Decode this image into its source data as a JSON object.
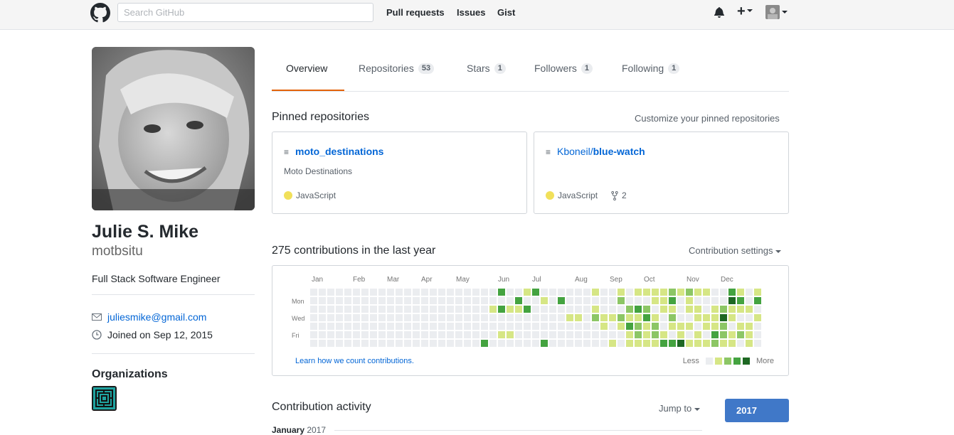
{
  "header": {
    "search_placeholder": "Search GitHub",
    "nav": [
      "Pull requests",
      "Issues",
      "Gist"
    ],
    "icons": [
      "github-logo-icon",
      "bell-icon",
      "plus-icon",
      "avatar"
    ]
  },
  "profile": {
    "name": "Julie S. Mike",
    "username": "motbsitu",
    "bio": "Full Stack Software Engineer",
    "email": "juliesmike@gmail.com",
    "joined": "Joined on Sep 12, 2015",
    "organizations_title": "Organizations"
  },
  "tabs": [
    {
      "label": "Overview",
      "count": null
    },
    {
      "label": "Repositories",
      "count": "53"
    },
    {
      "label": "Stars",
      "count": "1"
    },
    {
      "label": "Followers",
      "count": "1"
    },
    {
      "label": "Following",
      "count": "1"
    }
  ],
  "pinned": {
    "title": "Pinned repositories",
    "customize": "Customize your pinned repositories",
    "repos": [
      {
        "name": "moto_destinations",
        "owner": "",
        "description": "Moto Destinations",
        "language": "JavaScript",
        "forks": ""
      },
      {
        "name": "blue-watch",
        "owner": "Kboneil/",
        "description": "",
        "language": "JavaScript",
        "forks": "2"
      }
    ],
    "language_color": "#f1e05a"
  },
  "contributions": {
    "title": "275 contributions in the last year",
    "settings": "Contribution settings",
    "months": [
      "Jan",
      "Feb",
      "Mar",
      "Apr",
      "May",
      "Jun",
      "Jul",
      "Aug",
      "Sep",
      "Oct",
      "Nov",
      "Dec"
    ],
    "days": [
      "Mon",
      "Wed",
      "Fri"
    ],
    "learn_link": "Learn how we count contributions.",
    "legend_less": "Less",
    "legend_more": "More",
    "colors": [
      "#ebedf0",
      "#d6e685",
      "#8cc665",
      "#44a340",
      "#1e6823"
    ]
  },
  "activity": {
    "title": "Contribution activity",
    "jump_to": "Jump to",
    "year": "2017",
    "month_heading": "January",
    "month_year": "2017"
  }
}
